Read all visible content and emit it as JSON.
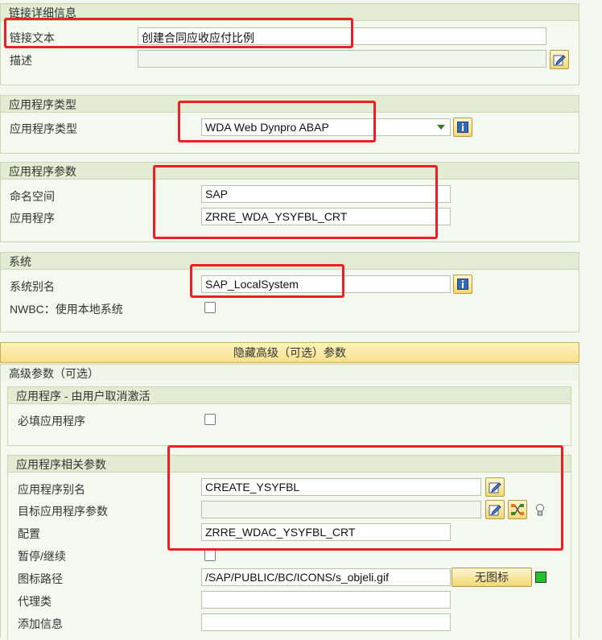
{
  "link_details": {
    "title": "链接详细信息",
    "link_text_label": "链接文本",
    "link_text_value": "创建合同应收应付比例",
    "description_label": "描述",
    "description_value": ""
  },
  "app_type": {
    "title": "应用程序类型",
    "label": "应用程序类型",
    "selected": "WDA Web Dynpro ABAP"
  },
  "app_params": {
    "title": "应用程序参数",
    "namespace_label": "命名空间",
    "namespace_value": "SAP",
    "application_label": "应用程序",
    "application_value": "ZRRE_WDA_YSYFBL_CRT"
  },
  "system": {
    "title": "系统",
    "alias_label": "系统别名",
    "alias_value": "SAP_LocalSystem",
    "nwbc_label": "NWBC：使用本地系统",
    "nwbc_checked": false
  },
  "toggle_advanced": "隐藏高级（可选）参数",
  "advanced": {
    "title": "高级参数（可选）",
    "deactivate": {
      "title": "应用程序 - 由用户取消激活",
      "mandatory_label": "必填应用程序"
    },
    "related": {
      "title": "应用程序相关参数",
      "alias_label": "应用程序别名",
      "alias_value": "CREATE_YSYFBL",
      "target_params_label": "目标应用程序参数",
      "target_params_value": "",
      "config_label": "配置",
      "config_value": "ZRRE_WDAC_YSYFBL_CRT",
      "suspend_label": "暂停/继续",
      "icon_path_label": "图标路径",
      "icon_path_value": "/SAP/PUBLIC/BC/ICONS/s_objeli.gif",
      "no_icon_button": "无图标",
      "proxy_label": "代理类",
      "proxy_value": "",
      "addinfo_label": "添加信息",
      "addinfo_value": ""
    }
  },
  "colors": {
    "highlight": "#ee1f24",
    "panel_header": "#e3ebd3",
    "status_green": "#22c22a"
  }
}
